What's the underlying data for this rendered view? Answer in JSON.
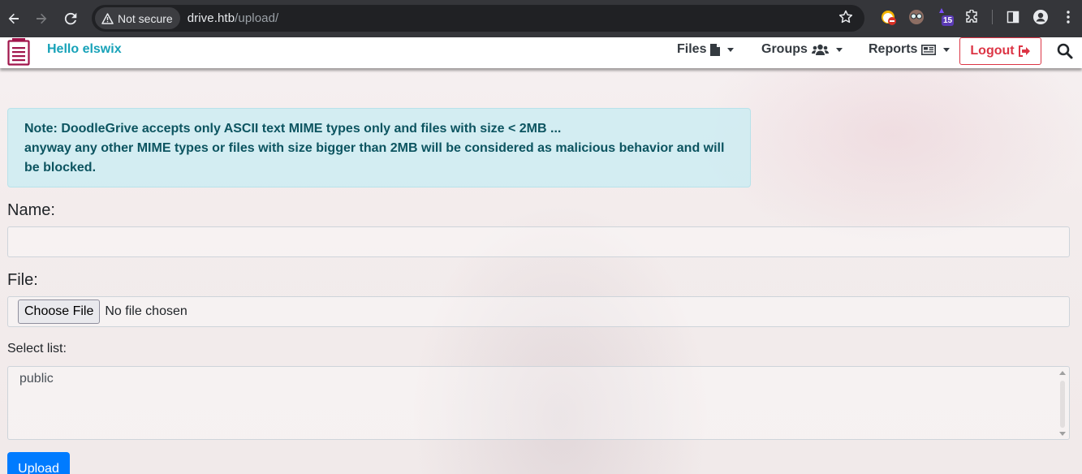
{
  "browser": {
    "security_label": "Not secure",
    "url_host": "drive.htb",
    "url_path": "/upload/",
    "extension_badge": "15"
  },
  "navbar": {
    "greeting": "Hello elswix",
    "files_label": "Files",
    "groups_label": "Groups",
    "reports_label": "Reports",
    "logout_label": "Logout",
    "brand_color": "#a0154b"
  },
  "alert": {
    "line1": "Note: DoodleGrive accepts only ASCII text MIME types only and files with size < 2MB ...",
    "line2": "anyway any other MIME types or files with size bigger than 2MB will be considered as malicious behavior and will be blocked."
  },
  "form": {
    "name_label": "Name:",
    "name_value": "",
    "file_label": "File:",
    "choose_file_label": "Choose File",
    "no_file_text": "No file chosen",
    "select_label": "Select list:",
    "select_options": [
      "public"
    ],
    "upload_label": "Upload"
  },
  "colors": {
    "info_text": "#0c5460",
    "greeting": "#17a2b8",
    "logout": "#dc3545",
    "primary": "#007bff"
  }
}
